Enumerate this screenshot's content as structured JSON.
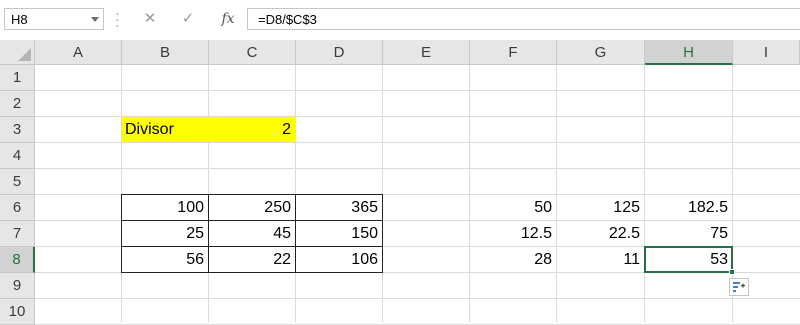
{
  "formula_bar": {
    "name_box": "H8",
    "cancel_icon": "✕",
    "enter_icon": "✓",
    "fx_label": "fx",
    "formula": "=D8/$C$3"
  },
  "columns": [
    "A",
    "B",
    "C",
    "D",
    "E",
    "F",
    "G",
    "H",
    "I"
  ],
  "rows": [
    "1",
    "2",
    "3",
    "4",
    "5",
    "6",
    "7",
    "8",
    "9",
    "10"
  ],
  "selected_cell": "H8",
  "cells": {
    "B3": "Divisor",
    "C3": "2",
    "B6": "100",
    "C6": "250",
    "D6": "365",
    "B7": "25",
    "C7": "45",
    "D7": "150",
    "B8": "56",
    "C8": "22",
    "D8": "106",
    "F6": "50",
    "G6": "125",
    "H6": "182.5",
    "F7": "12.5",
    "G7": "22.5",
    "H7": "75",
    "F8": "28",
    "G8": "11",
    "H8": "53"
  },
  "colors": {
    "highlight": "#ffff00",
    "accent": "#217346"
  },
  "icons": {
    "quick_analysis": "quick-analysis-icon"
  }
}
